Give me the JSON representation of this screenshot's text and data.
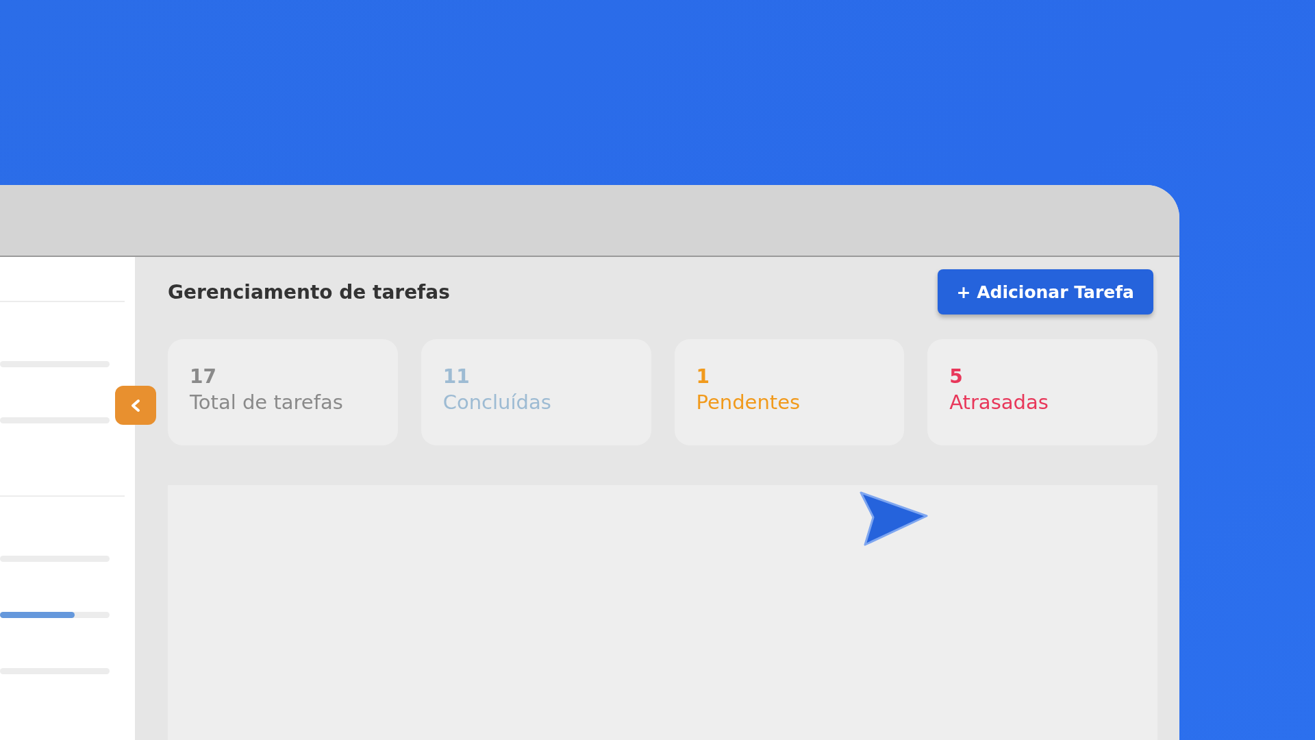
{
  "sidebar": {
    "groups": [
      {
        "tracks": [
          {
            "kind": "placeholder"
          },
          {
            "kind": "placeholder"
          }
        ]
      },
      {
        "tracks": [
          {
            "kind": "placeholder"
          },
          {
            "kind": "progress",
            "level": 0.68
          },
          {
            "kind": "placeholder"
          }
        ]
      }
    ]
  },
  "header": {
    "title": "Gerenciamento de tarefas",
    "add_button": "+ Adicionar Tarefa"
  },
  "stats": [
    {
      "value": "17",
      "label": "Total de tarefas",
      "color": "#8a8a8a"
    },
    {
      "value": "11",
      "label": "Concluídas",
      "color": "#9dbbd3"
    },
    {
      "value": "1",
      "label": "Pendentes",
      "color": "#f19a1c"
    },
    {
      "value": "5",
      "label": "Atrasadas",
      "color": "#e8375a"
    }
  ]
}
